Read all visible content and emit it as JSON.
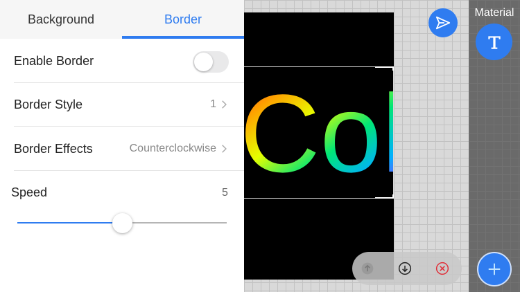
{
  "tabs": [
    {
      "label": "Background",
      "active": false
    },
    {
      "label": "Border",
      "active": true
    }
  ],
  "settings": {
    "enable_border": {
      "label": "Enable Border",
      "on": false
    },
    "border_style": {
      "label": "Border Style",
      "value": "1"
    },
    "border_effects": {
      "label": "Border Effects",
      "value": "Counterclockwise"
    },
    "speed": {
      "label": "Speed",
      "value": "5",
      "slider_fraction": 0.5
    }
  },
  "preview": {
    "text": "Col",
    "background": "#000000"
  },
  "material": {
    "title": "Material"
  },
  "icons": {
    "send": "send-icon",
    "text_tool": "text-tool-icon",
    "add": "plus-icon",
    "up": "arrow-up-icon",
    "down": "arrow-down-icon",
    "delete": "close-circle-icon"
  },
  "colors": {
    "accent": "#2f7cf0",
    "delete": "#e0303a"
  }
}
